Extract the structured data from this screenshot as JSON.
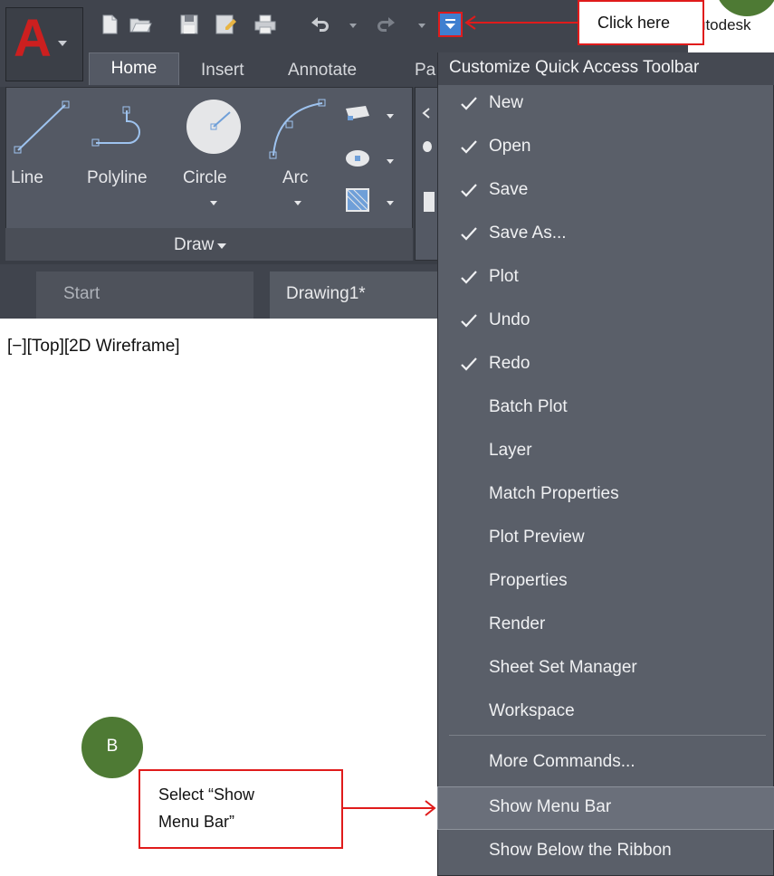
{
  "app": {
    "logo_letter": "A",
    "title_fragment": "utodesk"
  },
  "ribbon": {
    "tabs": [
      {
        "label": "Home",
        "active": true
      },
      {
        "label": "Insert",
        "active": false
      },
      {
        "label": "Annotate",
        "active": false
      },
      {
        "label": "Pa",
        "active": false
      }
    ],
    "draw_panel": {
      "tools": [
        {
          "label": "Line",
          "icon": "line-icon"
        },
        {
          "label": "Polyline",
          "icon": "polyline-icon"
        },
        {
          "label": "Circle",
          "icon": "circle-icon"
        },
        {
          "label": "Arc",
          "icon": "arc-icon"
        }
      ],
      "footer_label": "Draw"
    }
  },
  "documents": {
    "tabs": [
      {
        "label": "Start",
        "active": false
      },
      {
        "label": "Drawing1*",
        "active": true
      }
    ]
  },
  "viewport": {
    "label": "[−][Top][2D Wireframe]"
  },
  "menu": {
    "title": "Customize Quick Access Toolbar",
    "items": [
      {
        "label": "New",
        "checked": true
      },
      {
        "label": "Open",
        "checked": true
      },
      {
        "label": "Save",
        "checked": true
      },
      {
        "label": "Save As...",
        "checked": true
      },
      {
        "label": "Plot",
        "checked": true
      },
      {
        "label": "Undo",
        "checked": true
      },
      {
        "label": "Redo",
        "checked": true
      },
      {
        "label": "Batch Plot",
        "checked": false
      },
      {
        "label": "Layer",
        "checked": false
      },
      {
        "label": "Match Properties",
        "checked": false
      },
      {
        "label": "Plot Preview",
        "checked": false
      },
      {
        "label": "Properties",
        "checked": false
      },
      {
        "label": "Render",
        "checked": false
      },
      {
        "label": "Sheet Set Manager",
        "checked": false
      },
      {
        "label": "Workspace",
        "checked": false
      }
    ],
    "extra_items": [
      {
        "label": "More Commands..."
      },
      {
        "label": "Show Menu Bar",
        "highlighted": true
      },
      {
        "label": "Show Below the Ribbon"
      }
    ]
  },
  "annotations": {
    "callout_a_text": "Click here",
    "callout_b_letter": "B",
    "callout_b_line1": "Select “Show",
    "callout_b_line2": "Menu Bar”"
  },
  "colors": {
    "accent_red": "#e01b1b",
    "callout_green": "#4e7a34",
    "menu_bg": "#5a5f69",
    "qat_highlight": "#3f7fd0"
  }
}
